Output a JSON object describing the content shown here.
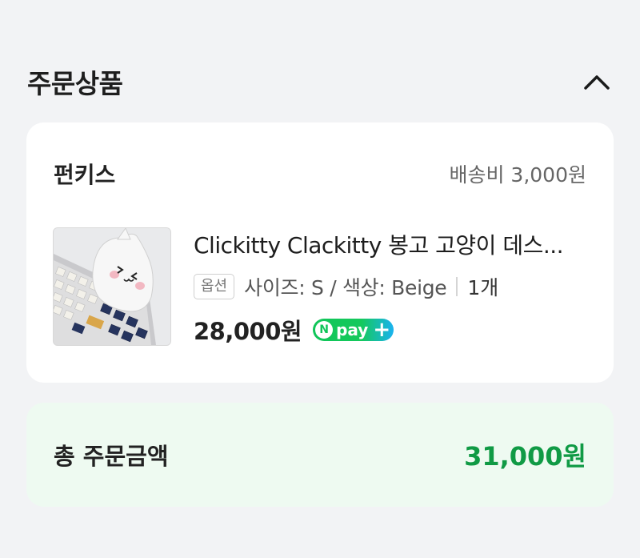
{
  "section": {
    "title": "주문상품",
    "collapse_icon": "chevron-up-icon"
  },
  "order": {
    "seller": "펀키스",
    "shipping": "배송비 3,000원",
    "product": {
      "name": "Clickitty Clackitty 봉고 고양이 데스...",
      "option_badge": "옵션",
      "option": "사이즈: S / 색상: Beige",
      "quantity": "1개",
      "price": "28,000원",
      "npay": {
        "n": "N",
        "text": "pay",
        "plus": "+"
      },
      "image_icon": "product-thumbnail"
    }
  },
  "total": {
    "label": "총 주문금액",
    "value": "31,000원"
  },
  "colors": {
    "accent_green": "#109a45",
    "background": "#f2f3f5",
    "total_bg": "#eefaf1"
  }
}
